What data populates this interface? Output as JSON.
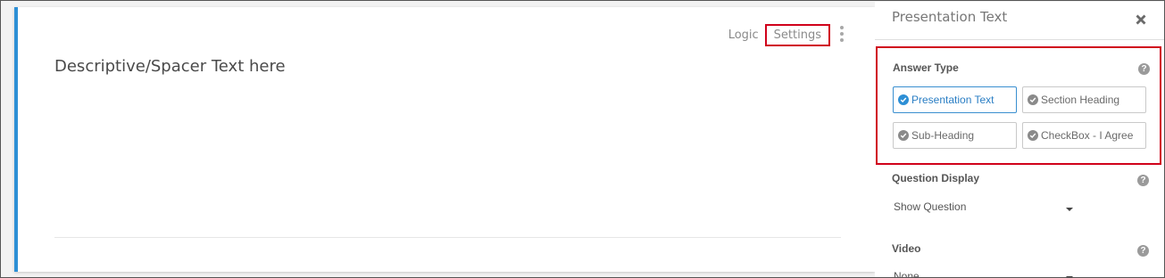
{
  "card": {
    "logic_label": "Logic",
    "settings_label": "Settings",
    "text": "Descriptive/Spacer Text here"
  },
  "panel": {
    "title": "Presentation Text",
    "answer_type": {
      "label": "Answer Type",
      "help": "?",
      "options": [
        {
          "label": "Presentation Text",
          "selected": true
        },
        {
          "label": "Section Heading",
          "selected": false
        },
        {
          "label": "Sub-Heading",
          "selected": false
        },
        {
          "label": "CheckBox - I Agree",
          "selected": false
        }
      ]
    },
    "question_display": {
      "label": "Question Display",
      "help": "?",
      "value": "Show Question"
    },
    "video": {
      "label": "Video",
      "help": "?",
      "value": "None"
    }
  },
  "colors": {
    "accent": "#2d8fd5",
    "highlight": "#d0021b"
  }
}
